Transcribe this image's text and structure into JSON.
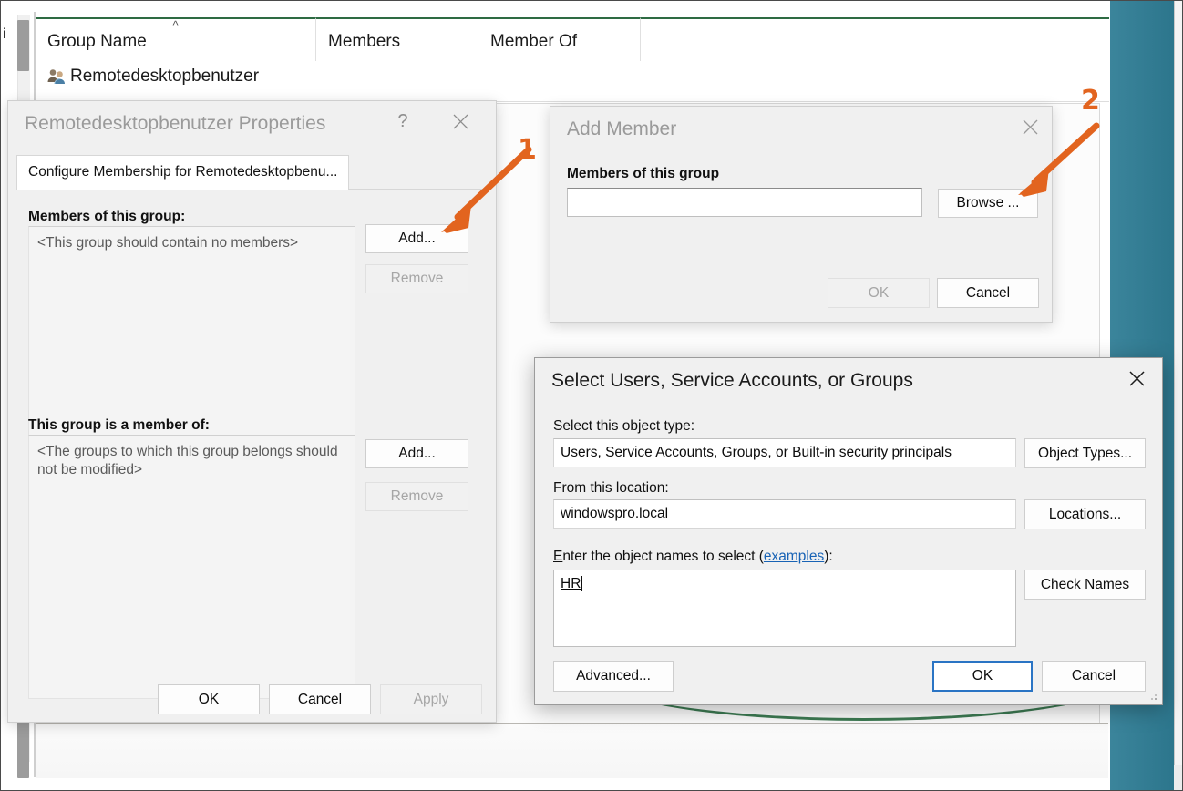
{
  "console": {
    "tree_pane_label": "i",
    "columns": [
      {
        "label": "Group Name",
        "sorted": true
      },
      {
        "label": "Members",
        "sorted": false
      },
      {
        "label": "Member Of",
        "sorted": false
      }
    ],
    "rows": [
      {
        "icon": "group-icon",
        "name": "Remotedesktopbenutzer"
      }
    ]
  },
  "properties_dialog": {
    "title": "Remotedesktopbenutzer Properties",
    "help_button": "?",
    "close_button": "✕",
    "tab_label": "Configure Membership for Remotedesktopbenu...",
    "members_label": "Members of this group:",
    "members_placeholder": "<This group should contain no members>",
    "members_add": "Add...",
    "members_remove": "Remove",
    "memberof_label": "This group is a member of:",
    "memberof_placeholder": "<The groups to which this group belongs should not be modified>",
    "memberof_add": "Add...",
    "memberof_remove": "Remove",
    "ok": "OK",
    "cancel": "Cancel",
    "apply": "Apply"
  },
  "add_member_dialog": {
    "title": "Add Member",
    "close_button": "✕",
    "field_label": "Members of this group",
    "field_value": "",
    "browse": "Browse ...",
    "ok": "OK",
    "cancel": "Cancel"
  },
  "select_users_dialog": {
    "title": "Select Users, Service Accounts, or Groups",
    "close_button": "✕",
    "object_type_label": "Select this object type:",
    "object_type_value": "Users, Service Accounts, Groups, or Built-in security principals",
    "object_types_button": "Object Types...",
    "location_label": "From this location:",
    "location_value": "windowspro.local",
    "locations_button": "Locations...",
    "names_label_before": "E",
    "names_label_mid": "nter the object names to select (",
    "names_label_link": "examples",
    "names_label_after": "):",
    "names_value": "HR",
    "check_names_button": "Check Names",
    "advanced_button": "Advanced...",
    "ok": "OK",
    "cancel": "Cancel"
  },
  "annotations": [
    {
      "number": "1",
      "target": "properties-add-members-button"
    },
    {
      "number": "2",
      "target": "add-member-browse-button"
    }
  ],
  "colors": {
    "annotation": "#e2641f",
    "desktop_teal": "#2f7d95",
    "column_accent_green": "#2e6b43",
    "default_button_blue": "#2a74c4",
    "link_blue": "#1863b5"
  }
}
